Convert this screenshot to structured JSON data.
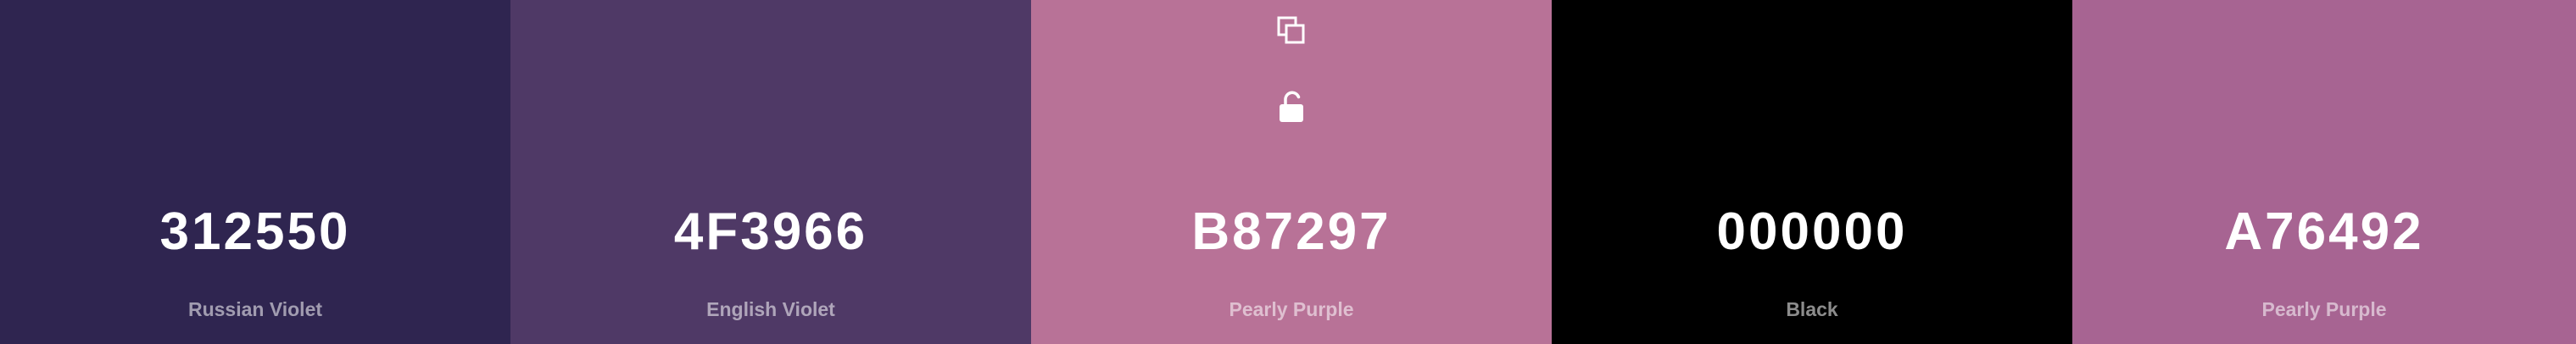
{
  "palette": {
    "swatches": [
      {
        "hex": "312550",
        "name": "Russian Violet",
        "color": "#2f2550"
      },
      {
        "hex": "4F3966",
        "name": "English Violet",
        "color": "#4f3966"
      },
      {
        "hex": "B87297",
        "name": "Pearly Purple",
        "color": "#b87297"
      },
      {
        "hex": "000000",
        "name": "Black",
        "color": "#000000"
      },
      {
        "hex": "A76492",
        "name": "Pearly Purple",
        "color": "#a76492"
      }
    ],
    "hovered_tools": {
      "copy_icon": "copy-icon",
      "lock_icon": "unlock-icon"
    }
  }
}
